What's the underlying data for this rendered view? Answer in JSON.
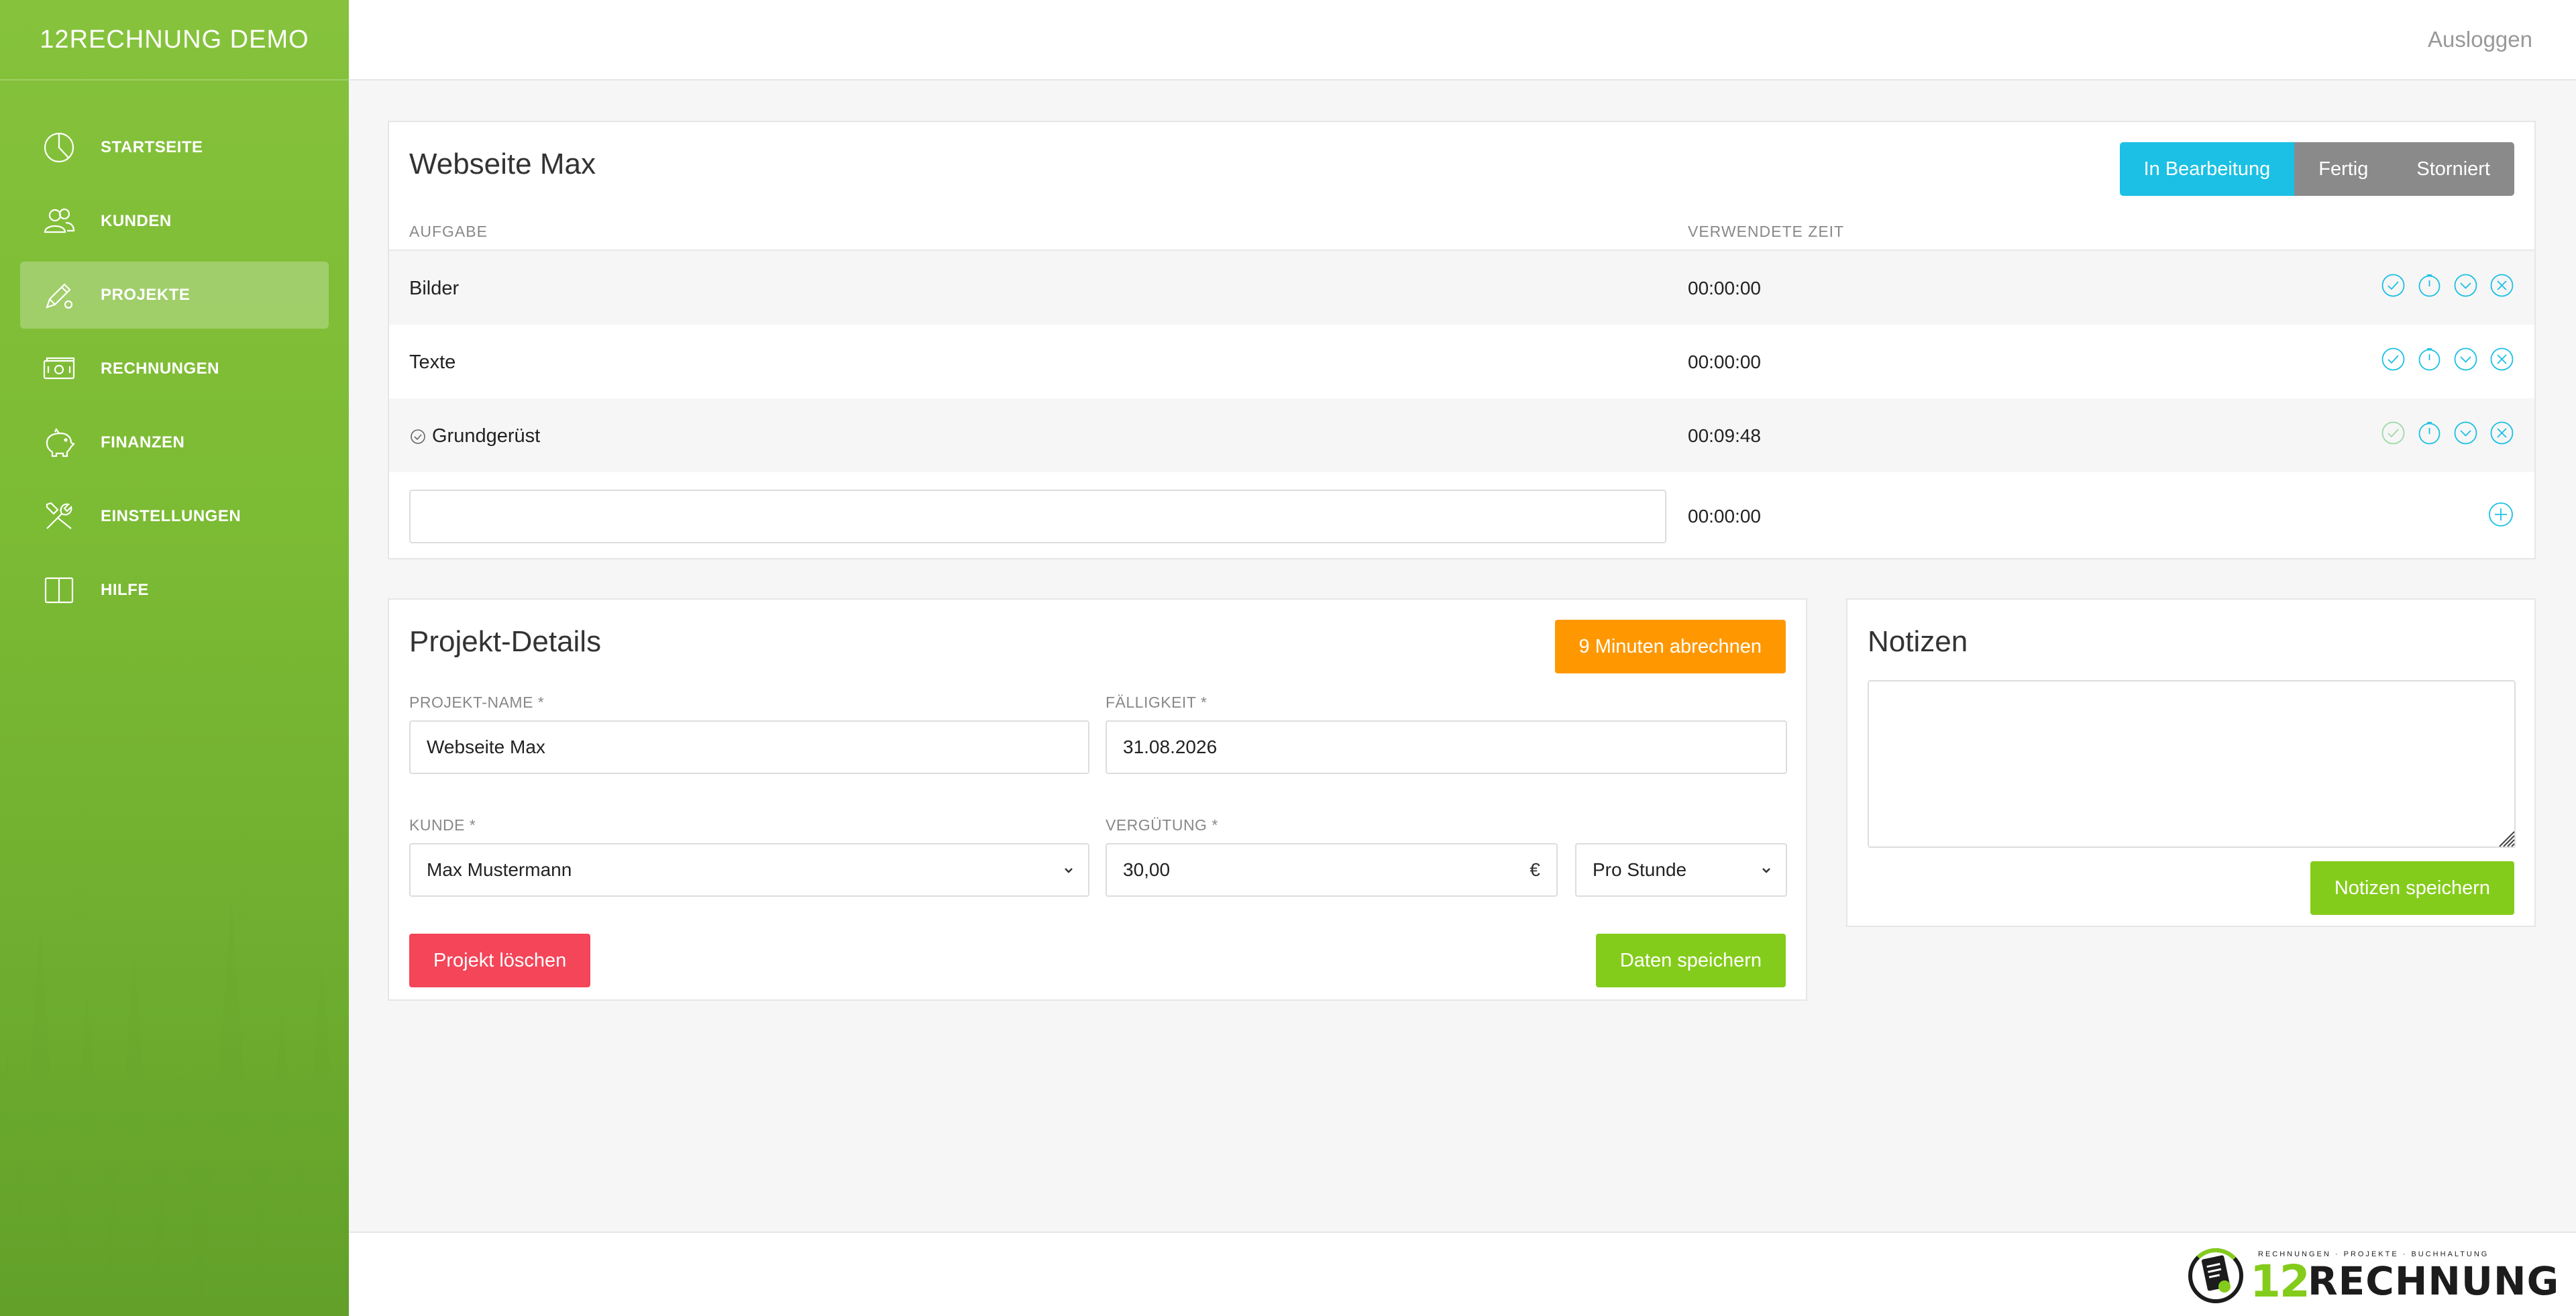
{
  "app": {
    "brand": "12RECHNUNG DEMO",
    "logout": "Ausloggen"
  },
  "sidebar": {
    "items": [
      {
        "label": "STARTSEITE",
        "icon": "pie-chart-icon"
      },
      {
        "label": "KUNDEN",
        "icon": "users-icon"
      },
      {
        "label": "PROJEKTE",
        "icon": "pen-icon",
        "active": true
      },
      {
        "label": "RECHNUNGEN",
        "icon": "money-icon"
      },
      {
        "label": "FINANZEN",
        "icon": "piggy-bank-icon"
      },
      {
        "label": "EINSTELLUNGEN",
        "icon": "tools-icon"
      },
      {
        "label": "HILFE",
        "icon": "book-icon"
      }
    ]
  },
  "project": {
    "title": "Webseite Max",
    "statuses": [
      {
        "label": "In Bearbeitung",
        "active": true
      },
      {
        "label": "Fertig",
        "active": false
      },
      {
        "label": "Storniert",
        "active": false
      }
    ],
    "columns": {
      "task": "AUFGABE",
      "time": "VERWENDETE ZEIT"
    },
    "tasks": [
      {
        "name": "Bilder",
        "time": "00:00:00",
        "done": false
      },
      {
        "name": "Texte",
        "time": "00:00:00",
        "done": false
      },
      {
        "name": "Grundgerüst",
        "time": "00:09:48",
        "done": true
      }
    ],
    "new_task": {
      "value": "",
      "placeholder": "",
      "time": "00:00:00"
    }
  },
  "details": {
    "title": "Projekt-Details",
    "bill_button": "9 Minuten abrechnen",
    "fields": {
      "name": {
        "label": "PROJEKT-NAME *",
        "value": "Webseite Max"
      },
      "due": {
        "label": "FÄLLIGKEIT *",
        "value": "31.08.2026"
      },
      "customer": {
        "label": "KUNDE *",
        "value": "Max Mustermann"
      },
      "rate": {
        "label": "VERGÜTUNG *",
        "value": "30,00",
        "currency": "€"
      },
      "unit": {
        "value": "Pro Stunde"
      }
    },
    "delete_button": "Projekt löschen",
    "save_button": "Daten speichern"
  },
  "notes": {
    "title": "Notizen",
    "value": "",
    "save_button": "Notizen speichern"
  },
  "footer": {
    "logo_number": "12",
    "logo_word": "RECHNUNG",
    "logo_tagline": "RECHNUNGEN · PROJEKTE · BUCHHALTUNG"
  },
  "colors": {
    "sidebar": "#7cbb34",
    "status_active": "#1bc0e4",
    "status_inactive": "#8a8a8a",
    "bill_orange": "#ff9800",
    "save_green": "#84cc1b",
    "delete_red": "#f44559"
  }
}
